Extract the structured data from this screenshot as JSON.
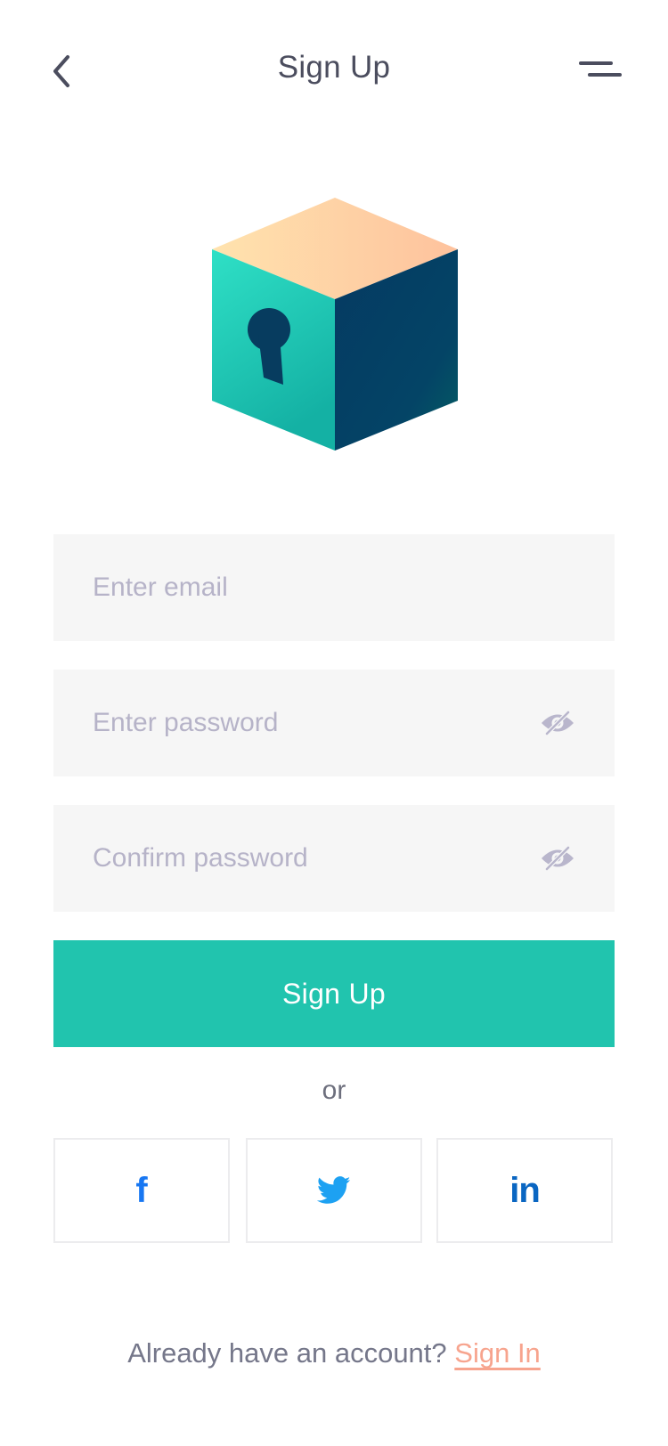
{
  "header": {
    "title": "Sign Up",
    "back_icon": "chevron-left-icon",
    "menu_icon": "menu-icon"
  },
  "illustration": {
    "icon": "locked-cube-icon"
  },
  "form": {
    "email_placeholder": "Enter email",
    "password_placeholder": "Enter password",
    "confirm_placeholder": "Confirm password",
    "eye_icon": "eye-off-icon",
    "submit_label": "Sign Up"
  },
  "divider_text": "or",
  "social": [
    {
      "network": "facebook",
      "icon": "facebook-icon",
      "glyph": "f",
      "color": "#1877f2"
    },
    {
      "network": "twitter",
      "icon": "twitter-icon",
      "color": "#1da1f2"
    },
    {
      "network": "linkedin",
      "icon": "linkedin-icon",
      "glyph": "in",
      "color": "#0a66c2"
    }
  ],
  "footer": {
    "prompt": "Already have an account?",
    "link_label": "Sign In"
  },
  "colors": {
    "accent": "#21c4ae",
    "title_text": "#4b4d5e",
    "placeholder": "#b6b3c8",
    "field_bg": "#f6f6f6",
    "link": "#f7a48e"
  }
}
